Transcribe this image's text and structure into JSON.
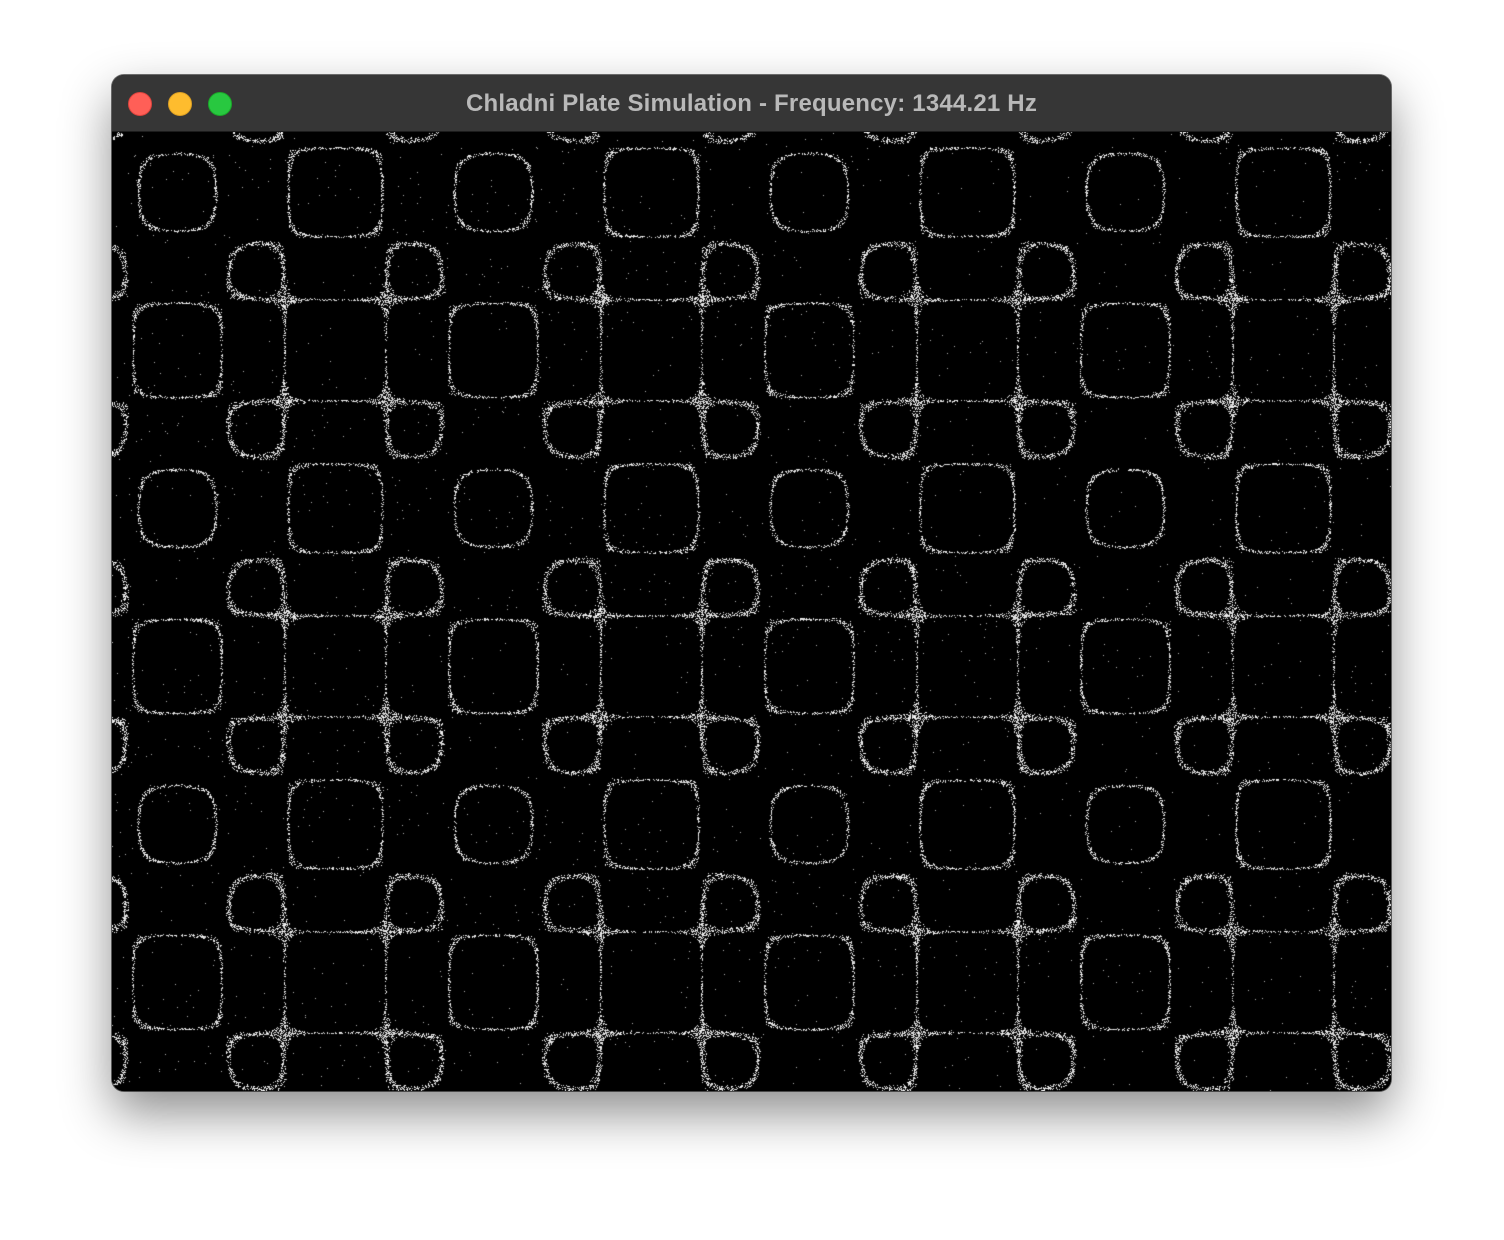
{
  "window": {
    "title": "Chladni Plate Simulation - Frequency: 1344.21 Hz",
    "controls": {
      "close_icon": "close-icon",
      "minimize_icon": "minimize-icon",
      "zoom_icon": "zoom-icon"
    }
  },
  "simulation": {
    "frequency_hz": 1344.21,
    "background_color": "#000000",
    "particle_color": "#ffffff",
    "titlebar_color": "#363636"
  }
}
